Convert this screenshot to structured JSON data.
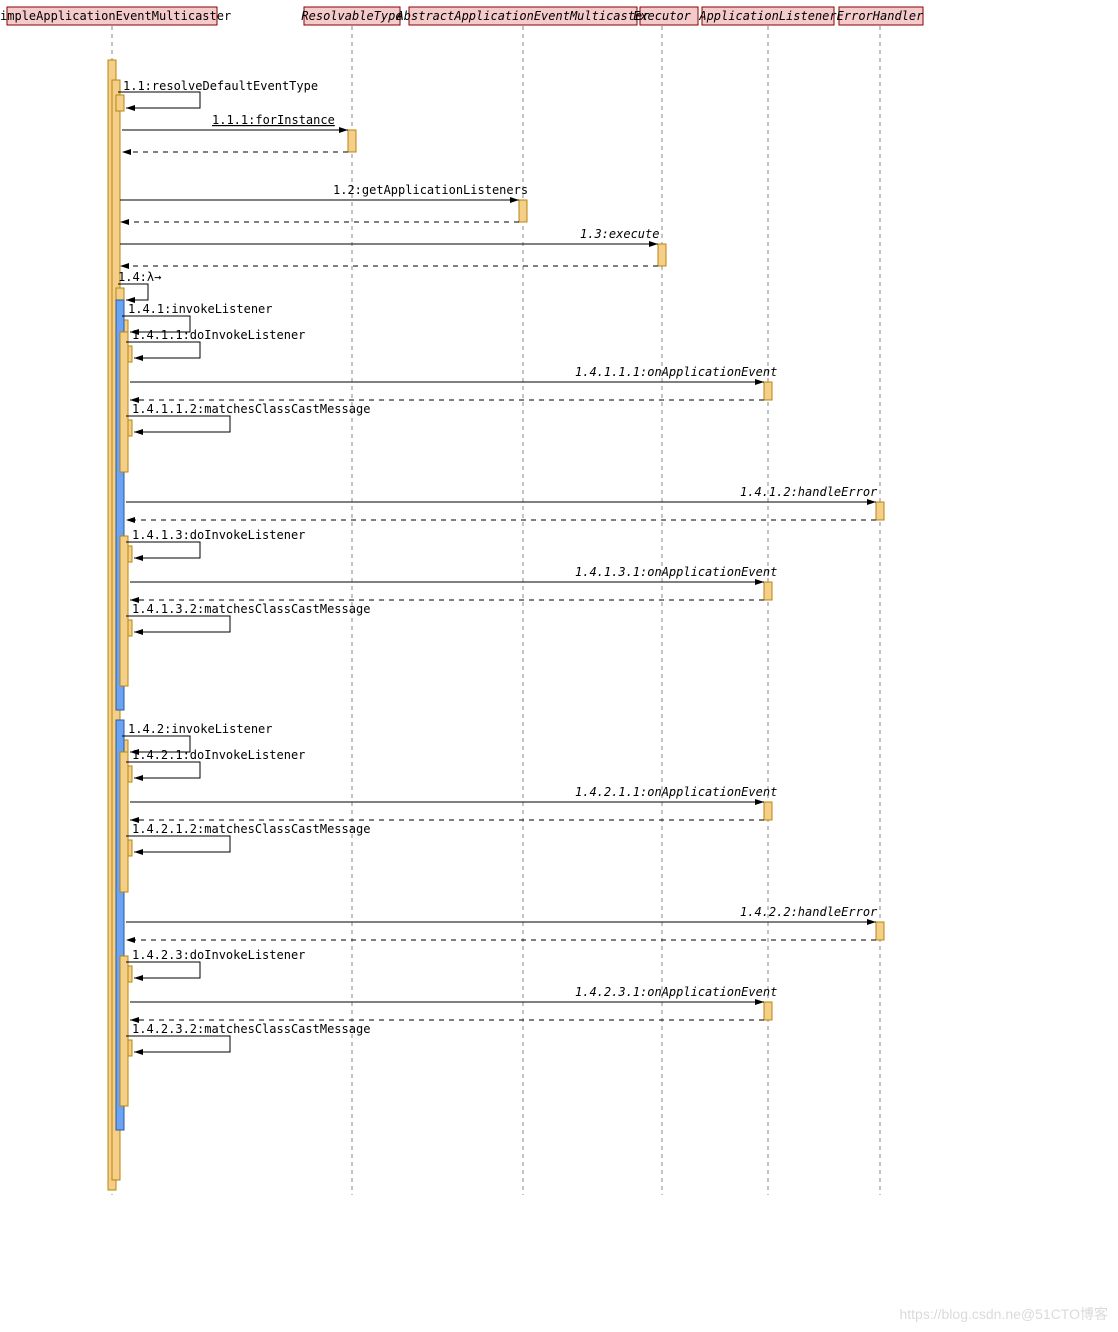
{
  "participants": {
    "p0": "SimpleApplicationEventMulticaster",
    "p1": "ResolvableType",
    "p2": "AbstractApplicationEventMulticaster",
    "p3": "Executor",
    "p4": "ApplicationListener",
    "p5": "ErrorHandler"
  },
  "messages": {
    "m1": "1.1:resolveDefaultEventType",
    "m2": "1.1.1:forInstance",
    "m3": "1.2:getApplicationListeners",
    "m4": "1.3:execute",
    "m5": "1.4:λ→",
    "m6": "1.4.1:invokeListener",
    "m7": "1.4.1.1:doInvokeListener",
    "m8": "1.4.1.1.1:onApplicationEvent",
    "m9": "1.4.1.1.2:matchesClassCastMessage",
    "m10": "1.4.1.2:handleError",
    "m11": "1.4.1.3:doInvokeListener",
    "m12": "1.4.1.3.1:onApplicationEvent",
    "m13": "1.4.1.3.2:matchesClassCastMessage",
    "m14": "1.4.2:invokeListener",
    "m15": "1.4.2.1:doInvokeListener",
    "m16": "1.4.2.1.1:onApplicationEvent",
    "m17": "1.4.2.1.2:matchesClassCastMessage",
    "m18": "1.4.2.2:handleError",
    "m19": "1.4.2.3:doInvokeListener",
    "m20": "1.4.2.3.1:onApplicationEvent",
    "m21": "1.4.2.3.2:matchesClassCastMessage"
  },
  "watermark": {
    "left": "https://blog.csdn.ne",
    "right": "@51CTO博客"
  }
}
